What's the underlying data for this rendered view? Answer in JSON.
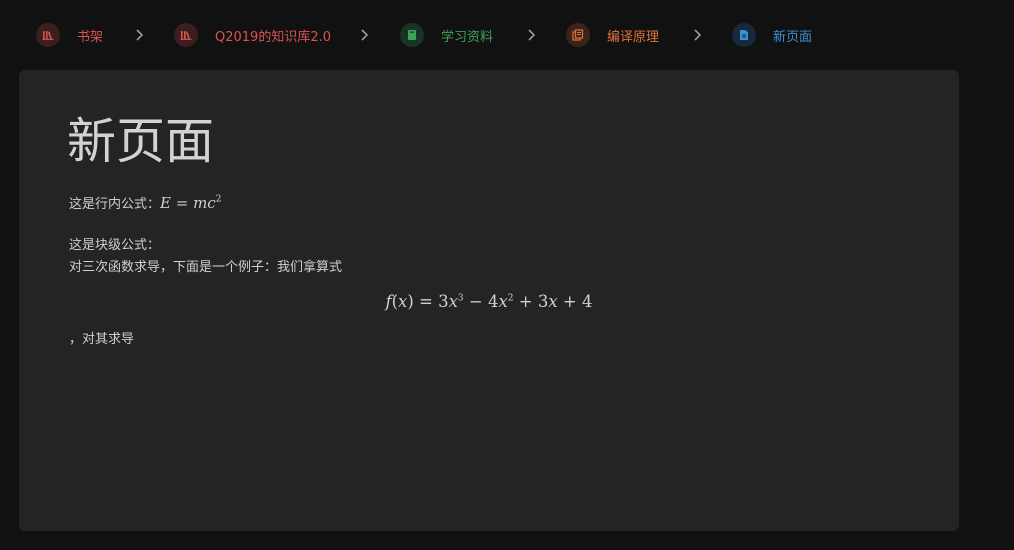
{
  "breadcrumb": {
    "items": [
      {
        "label": "书架",
        "icon": "library-icon",
        "color": "#d9534f",
        "bg": "#3b1f1f"
      },
      {
        "label": "Q2019的知识库2.0",
        "icon": "library-icon",
        "color": "#d9534f",
        "bg": "#3b1f1f"
      },
      {
        "label": "学习资料",
        "icon": "book-icon",
        "color": "#3aa55a",
        "bg": "#1b3326"
      },
      {
        "label": "编译原理",
        "icon": "chapter-icon",
        "color": "#e0733a",
        "bg": "#3a2419"
      },
      {
        "label": "新页面",
        "icon": "page-icon",
        "color": "#3b8fd6",
        "bg": "#17283a"
      }
    ],
    "separator_icon": "chevron-right-icon"
  },
  "page": {
    "title": "新页面",
    "inline_formula_prefix": "这是行内公式：",
    "inline_formula": "E = mc^2",
    "block_formula_label": "这是块级公式：",
    "intro_text": "对三次函数求导，下面是一个例子：我们拿算式",
    "display_formula": "f(x) = 3x^3 - 4x^2 + 3x + 4",
    "after_text": "，对其求导"
  }
}
